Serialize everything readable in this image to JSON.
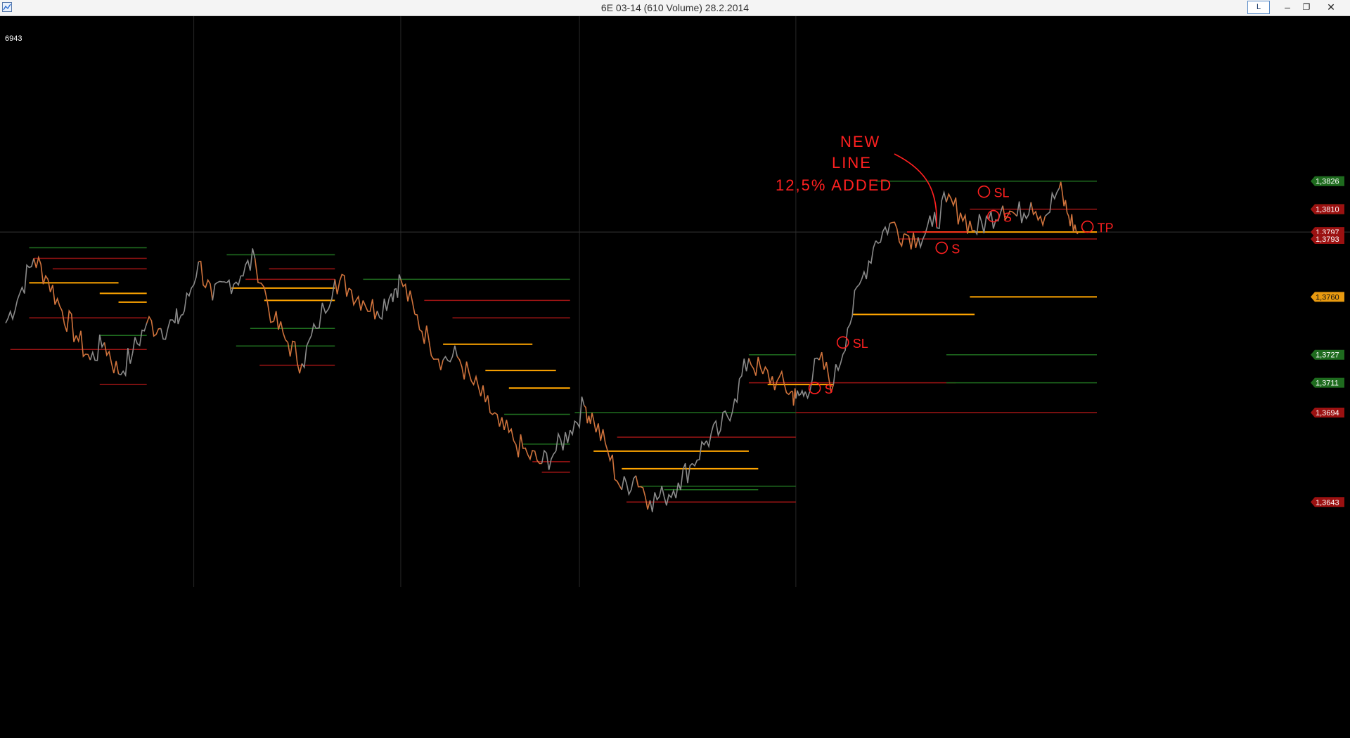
{
  "window": {
    "title": "6E 03-14 (610 Volume)  28.2.2014",
    "toggle_label": "L",
    "minimize_symbol": "–",
    "restore_symbol": "❐",
    "close_symbol": "✕"
  },
  "bar_counter": "6943",
  "colors": {
    "background": "#000000",
    "price_up": "#8a8a8a",
    "price_down": "#d0733c",
    "midline": "#ffa500",
    "support": "#1f6e1f",
    "resistance": "#a01515",
    "annotation": "#ff2020"
  },
  "chart_data": {
    "type": "line",
    "title": "",
    "xlabel": "",
    "ylabel": "",
    "ylim": [
      1.3595,
      1.388
    ],
    "x_sessions": 5,
    "price_series": [
      [
        0,
        1.3745
      ],
      [
        3,
        1.3762
      ],
      [
        6,
        1.3782
      ],
      [
        9,
        1.377
      ],
      [
        12,
        1.3752
      ],
      [
        15,
        1.3738
      ],
      [
        18,
        1.3724
      ],
      [
        21,
        1.3734
      ],
      [
        24,
        1.3716
      ],
      [
        27,
        1.3728
      ],
      [
        30,
        1.3745
      ],
      [
        33,
        1.3742
      ],
      [
        36,
        1.3745
      ],
      [
        38,
        1.3752
      ],
      [
        41,
        1.378
      ],
      [
        44,
        1.3758
      ],
      [
        47,
        1.3768
      ],
      [
        50,
        1.3772
      ],
      [
        53,
        1.3782
      ],
      [
        57,
        1.3746
      ],
      [
        60,
        1.3734
      ],
      [
        63,
        1.3722
      ],
      [
        66,
        1.3742
      ],
      [
        70,
        1.377
      ],
      [
        73,
        1.3765
      ],
      [
        76,
        1.3758
      ],
      [
        79,
        1.3752
      ],
      [
        82,
        1.3762
      ],
      [
        84,
        1.377
      ],
      [
        87,
        1.375
      ],
      [
        90,
        1.3735
      ],
      [
        93,
        1.3724
      ],
      [
        96,
        1.3726
      ],
      [
        99,
        1.3712
      ],
      [
        102,
        1.37
      ],
      [
        105,
        1.3686
      ],
      [
        108,
        1.3678
      ],
      [
        111,
        1.367
      ],
      [
        114,
        1.3665
      ],
      [
        117,
        1.3672
      ],
      [
        120,
        1.3684
      ],
      [
        123,
        1.3698
      ],
      [
        125,
        1.369
      ],
      [
        128,
        1.3672
      ],
      [
        131,
        1.365
      ],
      [
        134,
        1.3658
      ],
      [
        137,
        1.3644
      ],
      [
        140,
        1.3646
      ],
      [
        143,
        1.3654
      ],
      [
        146,
        1.3665
      ],
      [
        149,
        1.3678
      ],
      [
        152,
        1.3684
      ],
      [
        155,
        1.3702
      ],
      [
        158,
        1.3725
      ],
      [
        161,
        1.3716
      ],
      [
        164,
        1.3712
      ],
      [
        167,
        1.3706
      ],
      [
        168,
        1.3702
      ],
      [
        170,
        1.3706
      ],
      [
        173,
        1.3724
      ],
      [
        176,
        1.371
      ],
      [
        179,
        1.3742
      ],
      [
        182,
        1.377
      ],
      [
        185,
        1.3792
      ],
      [
        188,
        1.3802
      ],
      [
        191,
        1.3796
      ],
      [
        194,
        1.3794
      ],
      [
        197,
        1.38
      ],
      [
        200,
        1.3814
      ],
      [
        203,
        1.3808
      ],
      [
        206,
        1.3798
      ],
      [
        209,
        1.3804
      ],
      [
        212,
        1.3812
      ],
      [
        215,
        1.3806
      ],
      [
        218,
        1.3814
      ],
      [
        221,
        1.3806
      ],
      [
        224,
        1.3822
      ],
      [
        226,
        1.3806
      ],
      [
        228,
        1.3796
      ]
    ],
    "levels": [
      {
        "type": "support",
        "y": 1.3788,
        "x0": 5,
        "x1": 30
      },
      {
        "type": "resistance",
        "y": 1.3782,
        "x0": 6,
        "x1": 30
      },
      {
        "type": "resistance",
        "y": 1.3776,
        "x0": 10,
        "x1": 30
      },
      {
        "type": "midline",
        "y": 1.3768,
        "x0": 5,
        "x1": 24
      },
      {
        "type": "midline",
        "y": 1.3762,
        "x0": 20,
        "x1": 30
      },
      {
        "type": "midline",
        "y": 1.3757,
        "x0": 24,
        "x1": 30
      },
      {
        "type": "resistance",
        "y": 1.3748,
        "x0": 5,
        "x1": 30
      },
      {
        "type": "support",
        "y": 1.3738,
        "x0": 20,
        "x1": 30
      },
      {
        "type": "resistance",
        "y": 1.373,
        "x0": 1,
        "x1": 30
      },
      {
        "type": "resistance",
        "y": 1.371,
        "x0": 20,
        "x1": 30
      },
      {
        "type": "support",
        "y": 1.3784,
        "x0": 47,
        "x1": 70
      },
      {
        "type": "resistance",
        "y": 1.3776,
        "x0": 56,
        "x1": 70
      },
      {
        "type": "resistance",
        "y": 1.377,
        "x0": 51,
        "x1": 70
      },
      {
        "type": "midline",
        "y": 1.3765,
        "x0": 48,
        "x1": 70
      },
      {
        "type": "midline",
        "y": 1.3758,
        "x0": 55,
        "x1": 70
      },
      {
        "type": "support",
        "y": 1.3742,
        "x0": 52,
        "x1": 70
      },
      {
        "type": "support",
        "y": 1.3732,
        "x0": 49,
        "x1": 70
      },
      {
        "type": "resistance",
        "y": 1.3721,
        "x0": 54,
        "x1": 70
      },
      {
        "type": "support",
        "y": 1.377,
        "x0": 76,
        "x1": 120
      },
      {
        "type": "resistance",
        "y": 1.3758,
        "x0": 89,
        "x1": 120
      },
      {
        "type": "resistance",
        "y": 1.3748,
        "x0": 95,
        "x1": 120
      },
      {
        "type": "midline",
        "y": 1.3733,
        "x0": 93,
        "x1": 112
      },
      {
        "type": "midline",
        "y": 1.3718,
        "x0": 102,
        "x1": 117
      },
      {
        "type": "midline",
        "y": 1.3708,
        "x0": 107,
        "x1": 120
      },
      {
        "type": "support",
        "y": 1.3693,
        "x0": 106,
        "x1": 120
      },
      {
        "type": "support",
        "y": 1.3676,
        "x0": 110,
        "x1": 120
      },
      {
        "type": "resistance",
        "y": 1.3666,
        "x0": 112,
        "x1": 120
      },
      {
        "type": "resistance",
        "y": 1.366,
        "x0": 114,
        "x1": 120
      },
      {
        "type": "support",
        "y": 1.3694,
        "x0": 121,
        "x1": 168
      },
      {
        "type": "resistance",
        "y": 1.368,
        "x0": 130,
        "x1": 168
      },
      {
        "type": "midline",
        "y": 1.3672,
        "x0": 125,
        "x1": 158
      },
      {
        "type": "midline",
        "y": 1.3662,
        "x0": 131,
        "x1": 160
      },
      {
        "type": "support",
        "y": 1.3652,
        "x0": 135,
        "x1": 168
      },
      {
        "type": "support",
        "y": 1.365,
        "x0": 140,
        "x1": 160
      },
      {
        "type": "resistance",
        "y": 1.3643,
        "x0": 132,
        "x1": 168
      },
      {
        "type": "support",
        "y": 1.3727,
        "x0": 158,
        "x1": 168
      },
      {
        "type": "midline",
        "y": 1.371,
        "x0": 162,
        "x1": 176
      },
      {
        "type": "resistance",
        "y": 1.3711,
        "x0": 158,
        "x1": 202
      },
      {
        "type": "support",
        "y": 1.3826,
        "x0": 185,
        "x1": 232
      },
      {
        "type": "resistance",
        "y": 1.381,
        "x0": 205,
        "x1": 232
      },
      {
        "type": "midline",
        "y": 1.3797,
        "x0": 195,
        "x1": 232
      },
      {
        "type": "resistance",
        "y": 1.3793,
        "x0": 190,
        "x1": 232
      },
      {
        "type": "midline",
        "y": 1.376,
        "x0": 205,
        "x1": 232
      },
      {
        "type": "midline",
        "y": 1.375,
        "x0": 180,
        "x1": 206
      },
      {
        "type": "support",
        "y": 1.3727,
        "x0": 200,
        "x1": 232
      },
      {
        "type": "support",
        "y": 1.3711,
        "x0": 200,
        "x1": 232
      },
      {
        "type": "resistance",
        "y": 1.3694,
        "x0": 168,
        "x1": 232
      }
    ],
    "price_tags": [
      {
        "label": "1,3826",
        "y": 1.3826,
        "kind": "support"
      },
      {
        "label": "1,3810",
        "y": 1.381,
        "kind": "midline"
      },
      {
        "label": "1,3810",
        "y": 1.381,
        "kind": "resistance"
      },
      {
        "label": "1,3797",
        "y": 1.3797,
        "kind": "resistance"
      },
      {
        "label": "1,3793",
        "y": 1.3793,
        "kind": "resistance"
      },
      {
        "label": "1,3760",
        "y": 1.376,
        "kind": "midline"
      },
      {
        "label": "1,3727",
        "y": 1.3727,
        "kind": "support"
      },
      {
        "label": "1,3711",
        "y": 1.3711,
        "kind": "support"
      },
      {
        "label": "1,3694",
        "y": 1.3694,
        "kind": "resistance"
      },
      {
        "label": "1,3643",
        "y": 1.3643,
        "kind": "resistance"
      }
    ],
    "crosshair_y": 1.3797,
    "annotations": {
      "note_lines": [
        "NEW",
        "LINE",
        "12,5% ADDED"
      ],
      "marks": [
        {
          "text": "SL",
          "x": 178,
          "y": 1.3734
        },
        {
          "text": "S",
          "x": 172,
          "y": 1.3708
        },
        {
          "text": "S",
          "x": 199,
          "y": 1.3788
        },
        {
          "text": "SL",
          "x": 208,
          "y": 1.382
        },
        {
          "text": "S",
          "x": 210,
          "y": 1.3806
        },
        {
          "text": "TP",
          "x": 230,
          "y": 1.38
        }
      ]
    }
  }
}
